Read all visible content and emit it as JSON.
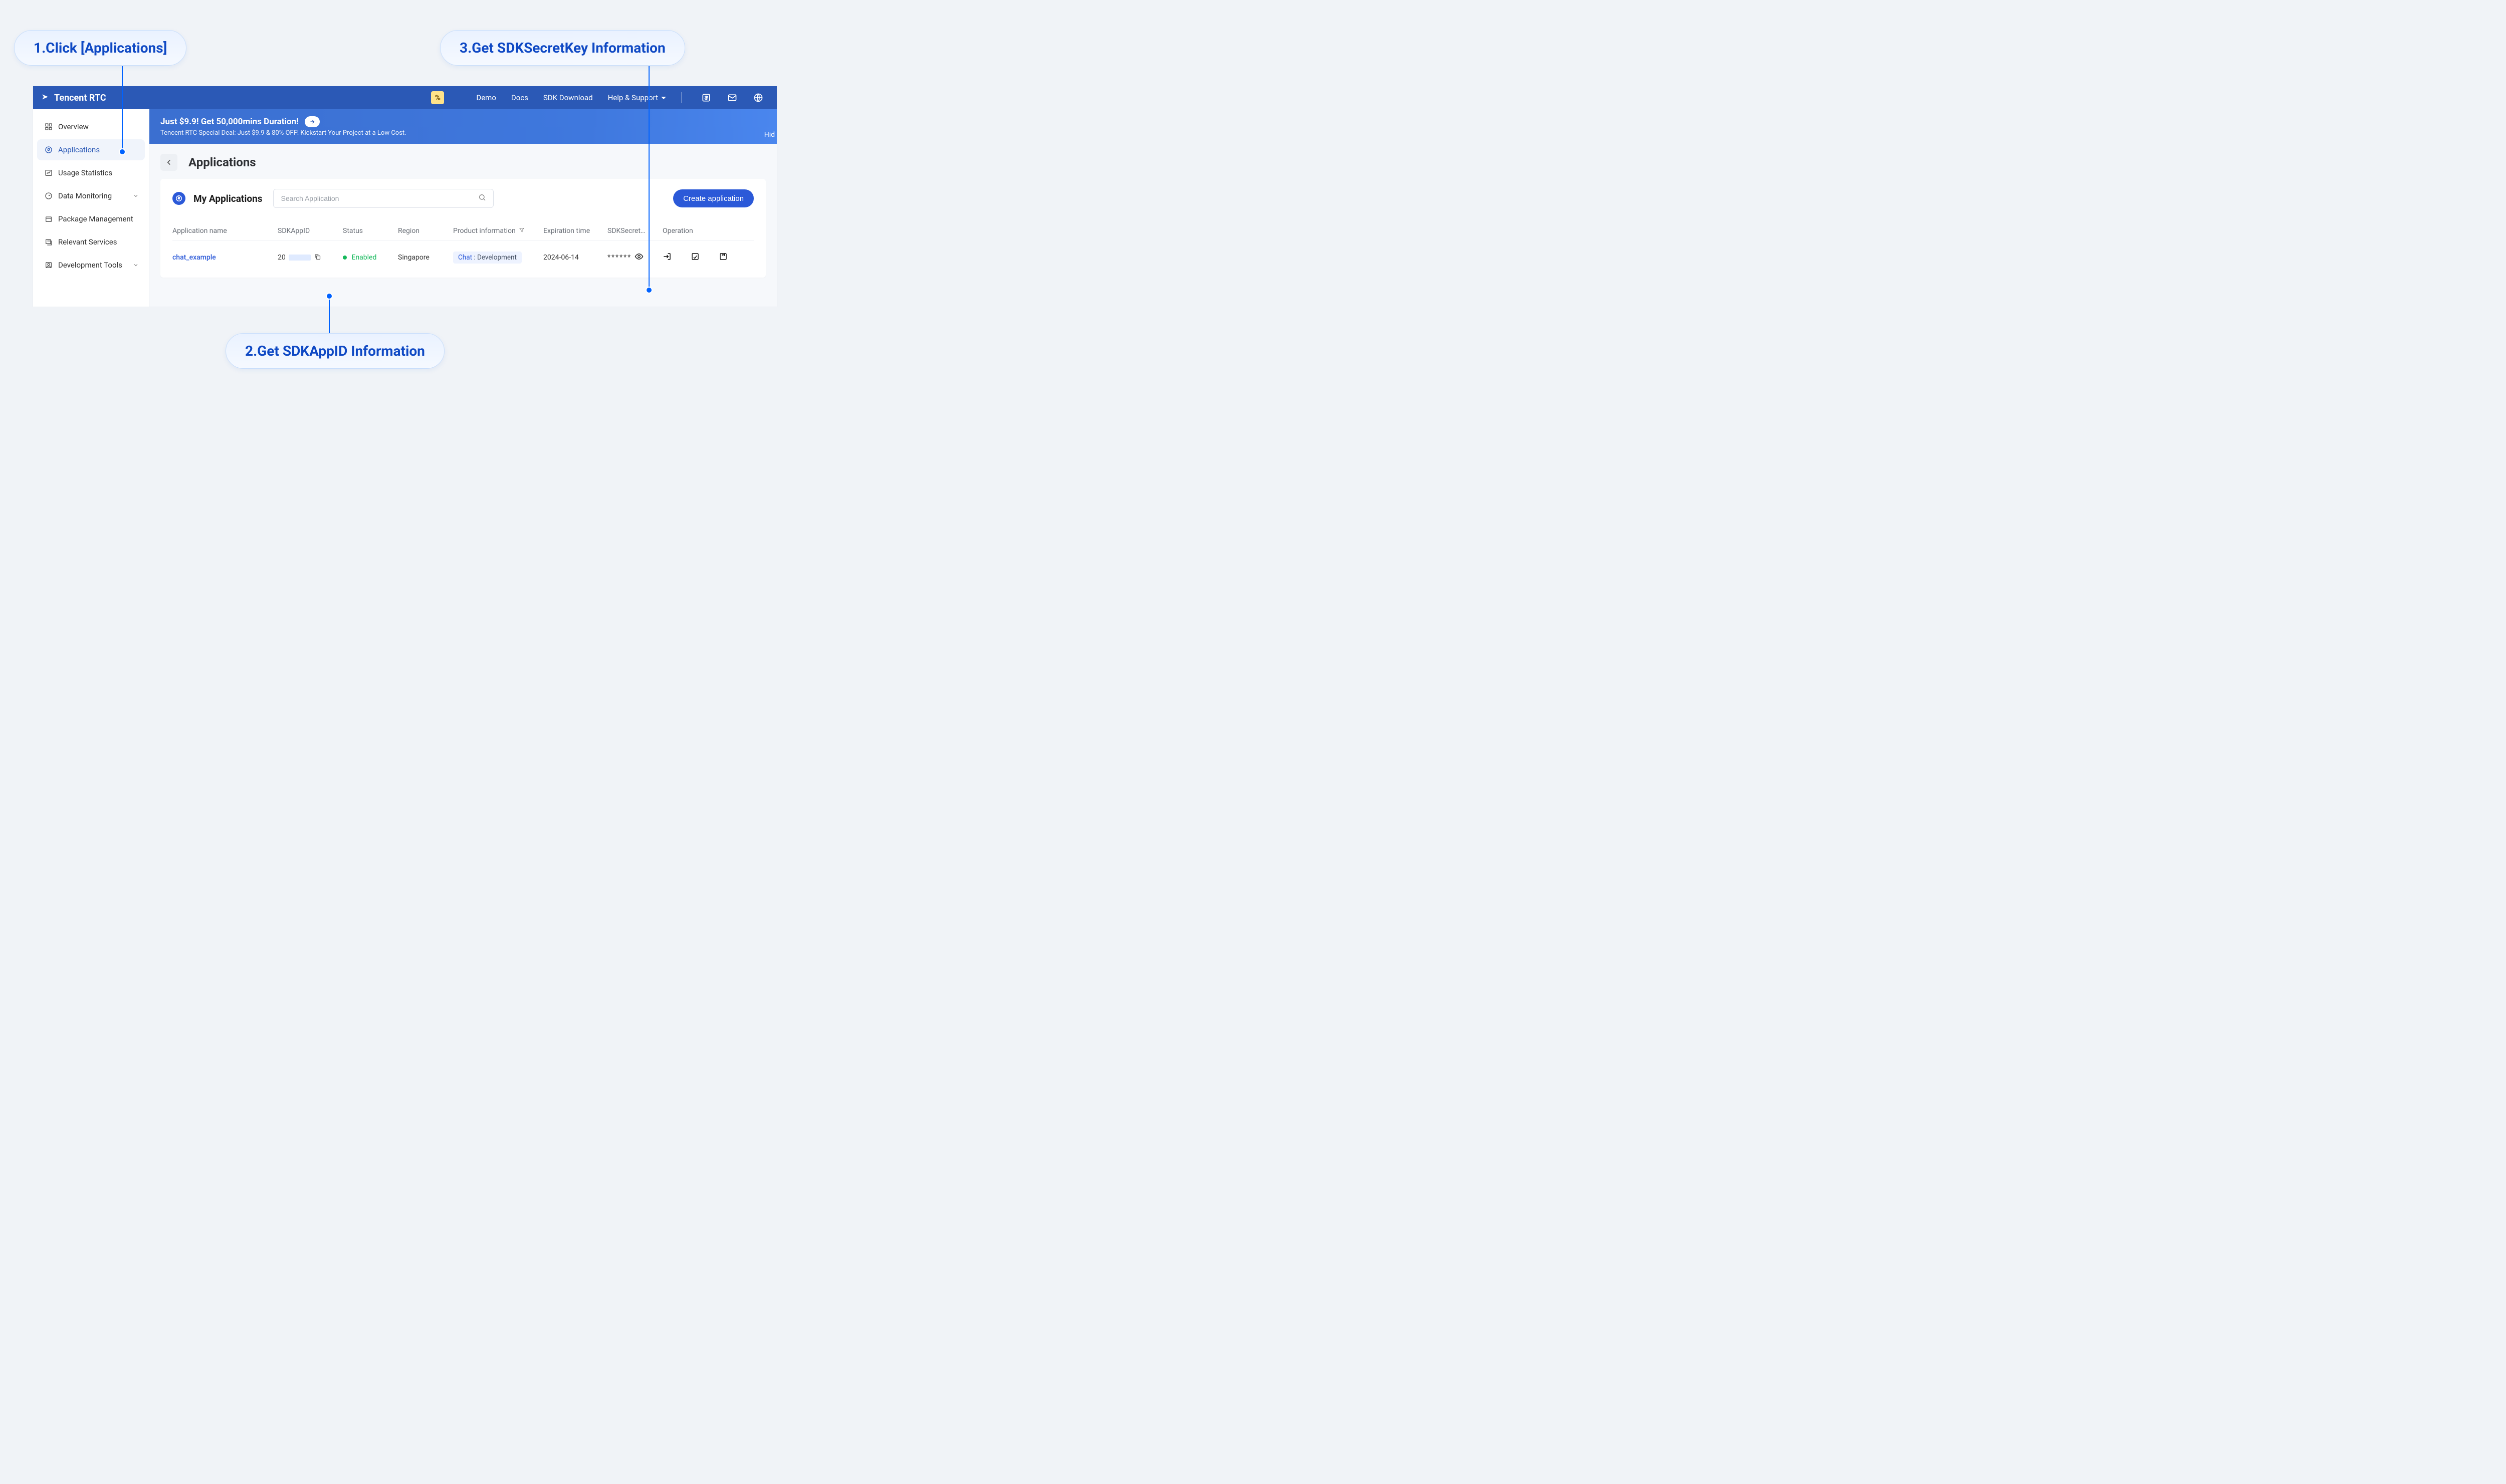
{
  "callouts": {
    "c1": "1.Click [Applications]",
    "c2": "2.Get SDKAppID Information",
    "c3": "3.Get SDKSecretKey Information"
  },
  "topbar": {
    "brand": "Tencent RTC",
    "promo_badge": "%",
    "links": {
      "demo": "Demo",
      "docs": "Docs",
      "sdk": "SDK Download",
      "help": "Help & Support"
    }
  },
  "sidebar": {
    "items": [
      {
        "label": "Overview"
      },
      {
        "label": "Applications"
      },
      {
        "label": "Usage Statistics"
      },
      {
        "label": "Data Monitoring"
      },
      {
        "label": "Package Management"
      },
      {
        "label": "Relevant Services"
      },
      {
        "label": "Development Tools"
      }
    ]
  },
  "banner": {
    "title": "Just $9.9! Get 50,000mins Duration!",
    "subtitle": "Tencent RTC Special Deal: Just $9.9 & 80% OFF! Kickstart Your Project at a Low Cost.",
    "hide": "Hid"
  },
  "page": {
    "title": "Applications"
  },
  "card": {
    "section_title": "My Applications",
    "search_placeholder": "Search Application",
    "create_label": "Create application"
  },
  "table": {
    "headers": {
      "appname": "Application name",
      "sdkappid": "SDKAppID",
      "status": "Status",
      "region": "Region",
      "product": "Product information",
      "expiration": "Expiration time",
      "secret": "SDKSecret…",
      "operation": "Operation"
    },
    "rows": [
      {
        "appname": "chat_example",
        "sdk_prefix": "20",
        "status": "Enabled",
        "region": "Singapore",
        "product_a": "Chat",
        "product_sep": " : ",
        "product_b": "Development",
        "expiration": "2024-06-14",
        "secret_mask": "******"
      }
    ]
  }
}
